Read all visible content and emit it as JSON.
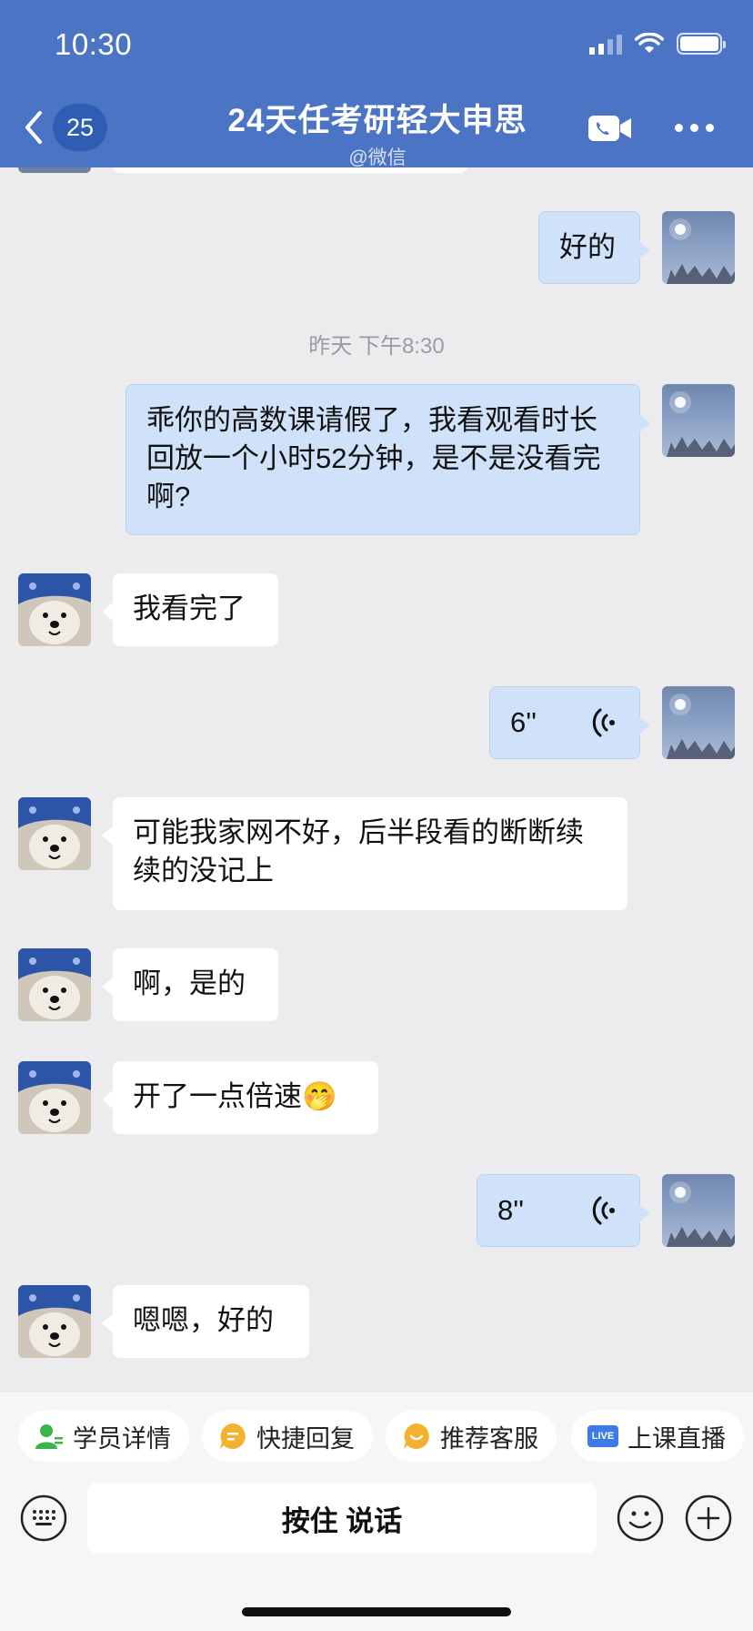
{
  "status_bar": {
    "time": "10:30"
  },
  "header": {
    "unread_count": "25",
    "title": "24天任考研轻大申思",
    "subtitle": "@微信",
    "accent_color": "#4b74c4"
  },
  "messages": [
    {
      "side": "right",
      "type": "text",
      "text": "好的"
    },
    {
      "type": "time",
      "text": "昨天 下午8:30"
    },
    {
      "side": "right",
      "type": "text",
      "text": "乖你的高数课请假了，我看观看时长回放一个小时52分钟，是不是没看完啊?"
    },
    {
      "side": "left",
      "type": "text",
      "text": "我看完了"
    },
    {
      "side": "right",
      "type": "voice",
      "duration": "6''"
    },
    {
      "side": "left",
      "type": "text",
      "text": "可能我家网不好，后半段看的断断续续的没记上"
    },
    {
      "side": "left",
      "type": "text",
      "text": "啊，是的"
    },
    {
      "side": "left",
      "type": "text",
      "text": "开了一点倍速🤭"
    },
    {
      "side": "right",
      "type": "voice",
      "duration": "8''"
    },
    {
      "side": "left",
      "type": "text",
      "text": "嗯嗯，好的"
    }
  ],
  "quick_actions": [
    {
      "label": "学员详情",
      "icon": "student-icon",
      "color": "#39b54a"
    },
    {
      "label": "快捷回复",
      "icon": "quick-reply-icon",
      "color": "#f2b230"
    },
    {
      "label": "推荐客服",
      "icon": "service-icon",
      "color": "#f2b230"
    },
    {
      "label": "上课直播",
      "icon": "live-icon",
      "color": "#3d7be6",
      "icon_text": "LIVE"
    }
  ],
  "input": {
    "hold_to_talk": "按住 说话"
  }
}
